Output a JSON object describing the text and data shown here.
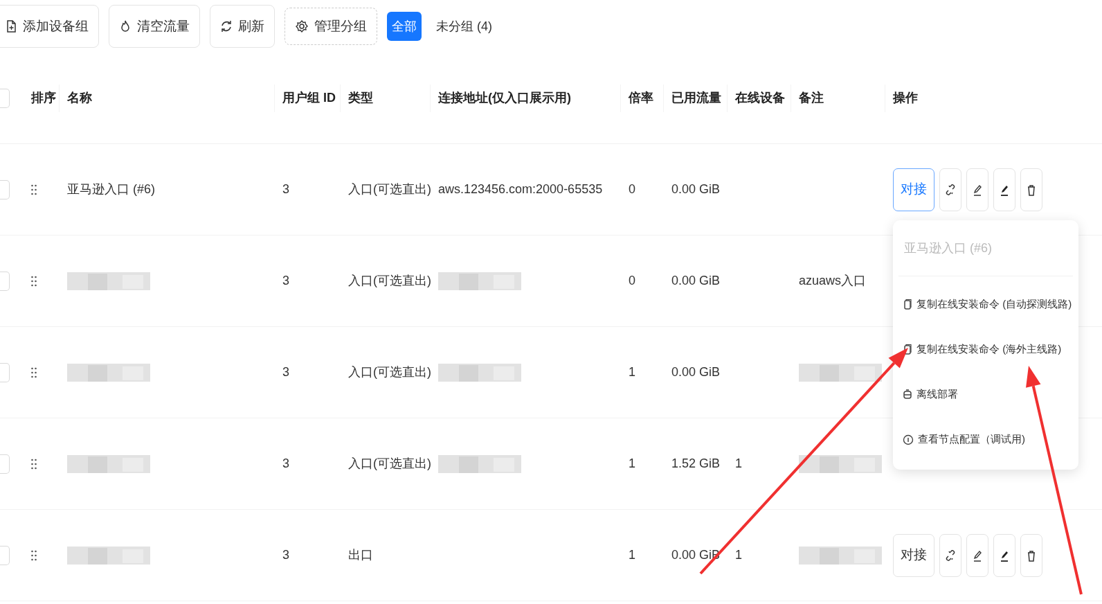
{
  "toolbar": {
    "buttons": [
      {
        "label": "添加设备组",
        "kind": "add"
      },
      {
        "label": "清空流量",
        "kind": "clear"
      },
      {
        "label": "刷新",
        "kind": "refresh"
      },
      {
        "label": "管理分组",
        "kind": "manage"
      }
    ],
    "filters": [
      {
        "label": "全部",
        "selected": true
      },
      {
        "label": "未分组 (4)",
        "selected": false
      }
    ]
  },
  "table": {
    "select_all": {
      "checked": false
    },
    "columns": [
      "排序",
      "名称",
      "用户组 ID",
      "类型",
      "连接地址(仅入口展示用)",
      "倍率",
      "已用流量",
      "在线设备",
      "备注",
      "操作"
    ],
    "rows": [
      {
        "checked": false,
        "cells": [
          {
            "kind": "handle"
          },
          {
            "text": "亚马逊入口 (#6)"
          },
          {
            "text": "3"
          },
          {
            "text": "入口(可选直出)"
          },
          {
            "text": "aws.123456.com:2000-65535"
          },
          {
            "text": "0"
          },
          {
            "text": "0.00 GiB"
          },
          null,
          null
        ],
        "actions": {
          "connect": "对接",
          "highlighted": true
        }
      },
      {
        "checked": false,
        "cells": [
          {
            "kind": "handle"
          },
          {
            "kind": "redacted"
          },
          {
            "text": "3"
          },
          {
            "text": "入口(可选直出)"
          },
          {
            "kind": "redacted"
          },
          {
            "text": "0"
          },
          {
            "text": "0.00 GiB"
          },
          null,
          {
            "text": "azuaws入口"
          }
        ]
      },
      {
        "checked": false,
        "cells": [
          {
            "kind": "handle"
          },
          {
            "kind": "redacted"
          },
          {
            "text": "3"
          },
          {
            "text": "入口(可选直出)"
          },
          {
            "kind": "redacted"
          },
          {
            "text": "1"
          },
          {
            "text": "0.00 GiB"
          },
          null,
          {
            "kind": "redacted"
          }
        ]
      },
      {
        "checked": false,
        "cells": [
          {
            "kind": "handle"
          },
          {
            "kind": "redacted"
          },
          {
            "text": "3"
          },
          {
            "text": "入口(可选直出)"
          },
          {
            "kind": "redacted"
          },
          {
            "text": "1"
          },
          {
            "text": "1.52 GiB"
          },
          {
            "text": "1"
          },
          {
            "kind": "redacted"
          }
        ]
      },
      {
        "checked": false,
        "cells": [
          {
            "kind": "handle"
          },
          {
            "kind": "redacted"
          },
          {
            "text": "3"
          },
          {
            "text": "出口"
          },
          null,
          {
            "text": "1"
          },
          {
            "text": "0.00 GiB"
          },
          {
            "text": "1"
          },
          {
            "kind": "redacted"
          }
        ],
        "actions": {
          "connect": "对接",
          "highlighted": false
        }
      }
    ]
  },
  "dropdown_menu": {
    "title": "亚马逊入口 (#6)",
    "items": [
      {
        "kind": "copy",
        "label": "复制在线安装命令 (自动探测线路)"
      },
      {
        "kind": "copy",
        "label": "复制在线安装命令 (海外主线路)"
      },
      {
        "kind": "offline",
        "label": "离线部署"
      },
      {
        "kind": "info",
        "label": "查看节点配置（调试用)"
      }
    ]
  },
  "annotations": [
    {
      "kind": "arrow"
    },
    {
      "kind": "arrow"
    }
  ]
}
